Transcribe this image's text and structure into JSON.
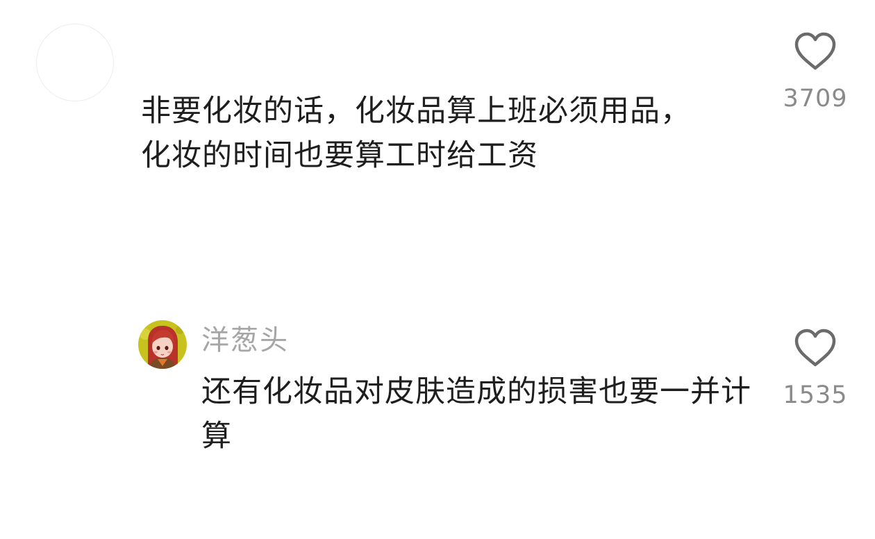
{
  "comments": [
    {
      "username": "",
      "text": "非要化妆的话，化妆品算上班必须用品，化妆的时间也要算工时给工资",
      "likes": "3709",
      "icons": {
        "avatar": "blank-avatar-icon",
        "like": "heart-outline-icon"
      }
    },
    {
      "username": "洋葱头",
      "text": "还有化妆品对皮肤造成的损害也要一并计算",
      "likes": "1535",
      "icons": {
        "avatar": "red-haired-girl-avatar-icon",
        "like": "heart-outline-icon"
      }
    }
  ],
  "colors": {
    "text": "#1e1e1e",
    "username": "#a6a6a6",
    "count": "#8a8a8a",
    "heart": "#6b6b6b",
    "avatar_bg": "#c8c21e"
  }
}
